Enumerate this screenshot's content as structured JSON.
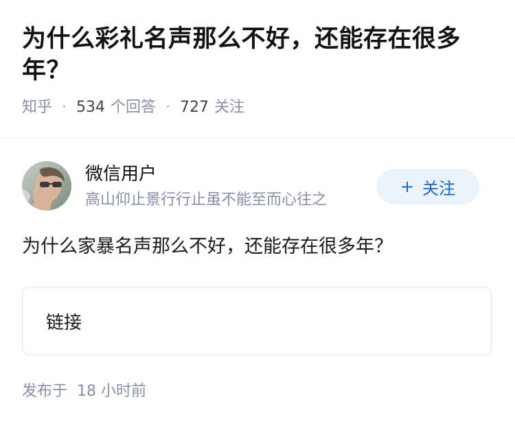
{
  "question": {
    "title": "为什么彩礼名声那么不好，还能存在很多年？",
    "source": "知乎",
    "answer_count": "534",
    "answer_label": "个回答",
    "follower_count": "727",
    "follower_label": "关注"
  },
  "author": {
    "name": "微信用户",
    "bio": "高山仰止景行行止虽不能至而心往之",
    "avatar_icon": "user-avatar-photo",
    "follow_label": "关注",
    "follow_icon": "plus-icon"
  },
  "answer": {
    "text": "为什么家暴名声那么不好，还能存在很多年？",
    "link_label": "链接",
    "published_prefix": "发布于",
    "published_time": "18 小时前"
  },
  "colors": {
    "accent": "#1a66c6",
    "follow_bg": "#eaf2fb",
    "meta_gray": "#8590a6"
  }
}
